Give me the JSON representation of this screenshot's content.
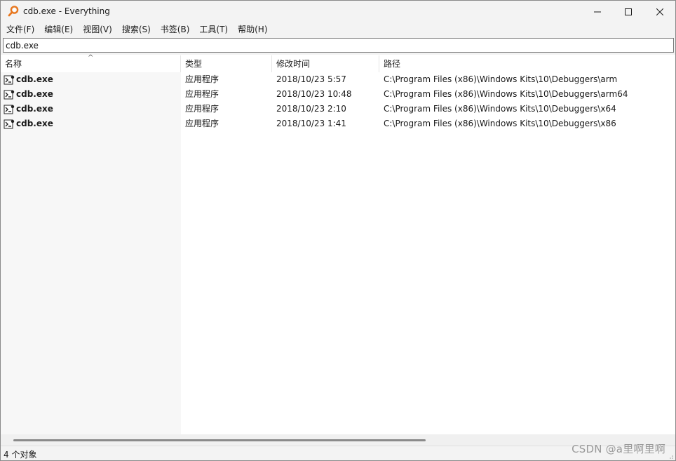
{
  "window": {
    "title": "cdb.exe - Everything",
    "icon": "magnifier-icon"
  },
  "menu": {
    "items": [
      {
        "label": "文件(F)"
      },
      {
        "label": "编辑(E)"
      },
      {
        "label": "视图(V)"
      },
      {
        "label": "搜索(S)"
      },
      {
        "label": "书签(B)"
      },
      {
        "label": "工具(T)"
      },
      {
        "label": "帮助(H)"
      }
    ]
  },
  "search": {
    "value": "cdb.exe"
  },
  "columns": {
    "name": "名称",
    "type": "类型",
    "modified": "修改时间",
    "path": "路径",
    "sort_indicator": "^"
  },
  "rows": [
    {
      "name": "cdb.exe",
      "type": "应用程序",
      "modified": "2018/10/23 5:57",
      "path": "C:\\Program Files (x86)\\Windows Kits\\10\\Debuggers\\arm"
    },
    {
      "name": "cdb.exe",
      "type": "应用程序",
      "modified": "2018/10/23 10:48",
      "path": "C:\\Program Files (x86)\\Windows Kits\\10\\Debuggers\\arm64"
    },
    {
      "name": "cdb.exe",
      "type": "应用程序",
      "modified": "2018/10/23 2:10",
      "path": "C:\\Program Files (x86)\\Windows Kits\\10\\Debuggers\\x64"
    },
    {
      "name": "cdb.exe",
      "type": "应用程序",
      "modified": "2018/10/23 1:41",
      "path": "C:\\Program Files (x86)\\Windows Kits\\10\\Debuggers\\x86"
    }
  ],
  "status": {
    "text": "4 个对象"
  },
  "watermark": "CSDN @a里啊里啊",
  "colors": {
    "accent_icon": "#e8771e",
    "chrome_bg": "#f3f3f3",
    "name_col_bg": "#f7f7f7"
  }
}
